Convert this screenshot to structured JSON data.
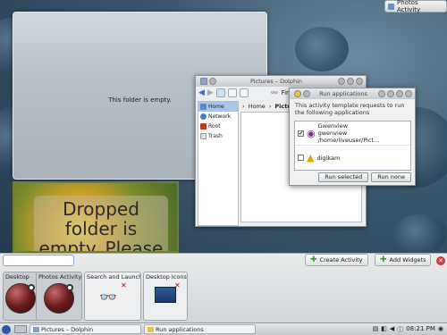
{
  "activity_badge": {
    "label": "Photos Activity"
  },
  "folder_view": {
    "message": "This folder is empty."
  },
  "dropped_folder": {
    "message": "Dropped folder is empty. Please drop a folder."
  },
  "dolphin": {
    "title": "Pictures – Dolphin",
    "find_label": "Fin",
    "places": [
      "Home",
      "Network",
      "Root",
      "Trash"
    ],
    "breadcrumb": [
      "Home",
      "Pictur"
    ]
  },
  "run_apps": {
    "title": "Run applications",
    "intro": "This activity template requests to run the following applications",
    "apps": [
      {
        "name": "Gwenview",
        "detail": "gwenview /home/liveuser/Pict...",
        "checked": true
      },
      {
        "name": "digikam",
        "detail": "",
        "checked": false
      }
    ],
    "run_selected": "Run selected",
    "run_none": "Run none"
  },
  "toolbox": {
    "search_placeholder": "",
    "create_activity": "Create Activity",
    "add_widgets": "Add Widgets",
    "widgets": [
      "Desktop",
      "Photos Activity",
      "Search and Launch",
      "Desktop Icons"
    ]
  },
  "taskbar": {
    "tasks": [
      "Pictures – Dolphin",
      "Run applications"
    ],
    "clock": "08:21 PM"
  }
}
